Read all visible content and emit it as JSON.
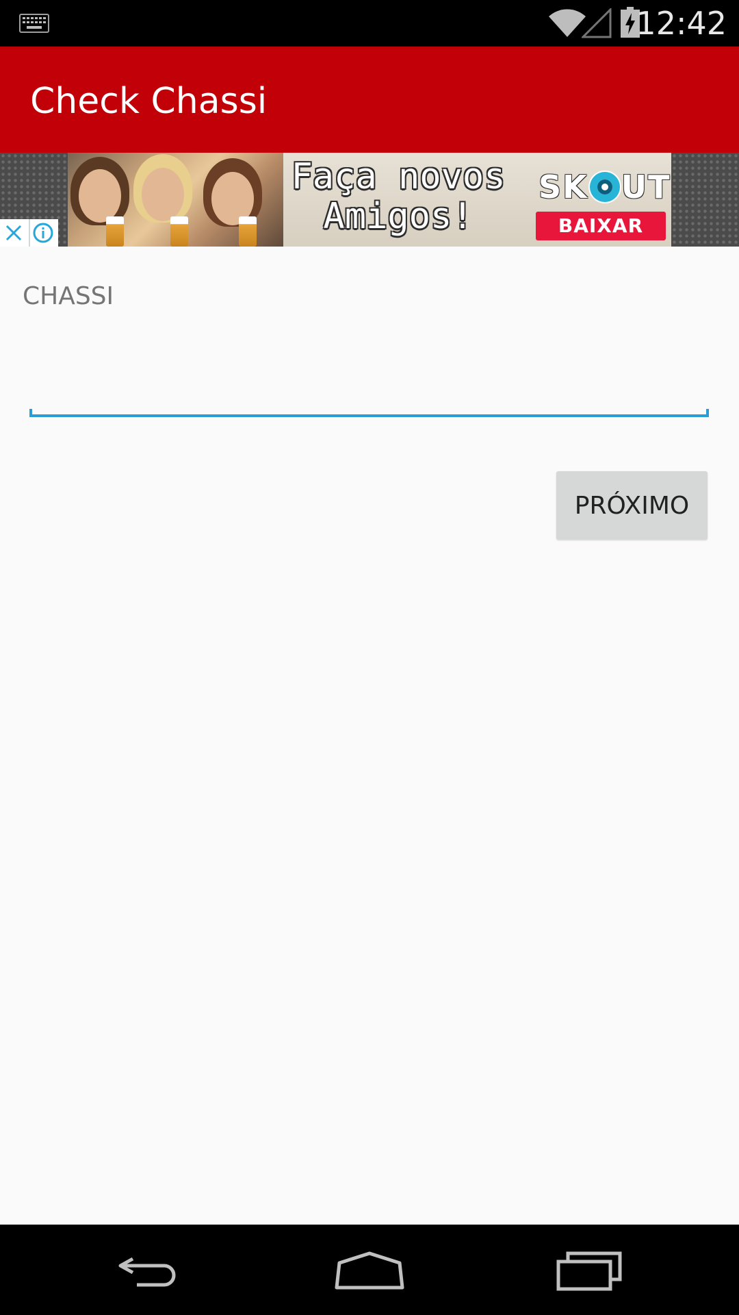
{
  "status_bar": {
    "time": "12:42",
    "icons": [
      "keyboard-icon",
      "wifi-icon",
      "cell-signal-icon",
      "battery-charging-icon"
    ]
  },
  "app_bar": {
    "title": "Check Chassi",
    "color": "#c20008"
  },
  "ad": {
    "headline": "Faça novos\nAmigos!",
    "brand": "SKOUT",
    "cta": "BAIXAR",
    "controls": [
      "close-icon",
      "info-icon"
    ],
    "colors": {
      "cta": "#e8163b",
      "brand_accent": "#27b4d6",
      "control_icon": "#27a6d9"
    }
  },
  "form": {
    "label": "CHASSI",
    "input_value": "",
    "accent_color": "#2a9ed4",
    "next_button": "PRÓXIMO"
  },
  "nav_bar": {
    "buttons": [
      "back-icon",
      "home-icon",
      "recents-icon"
    ]
  }
}
